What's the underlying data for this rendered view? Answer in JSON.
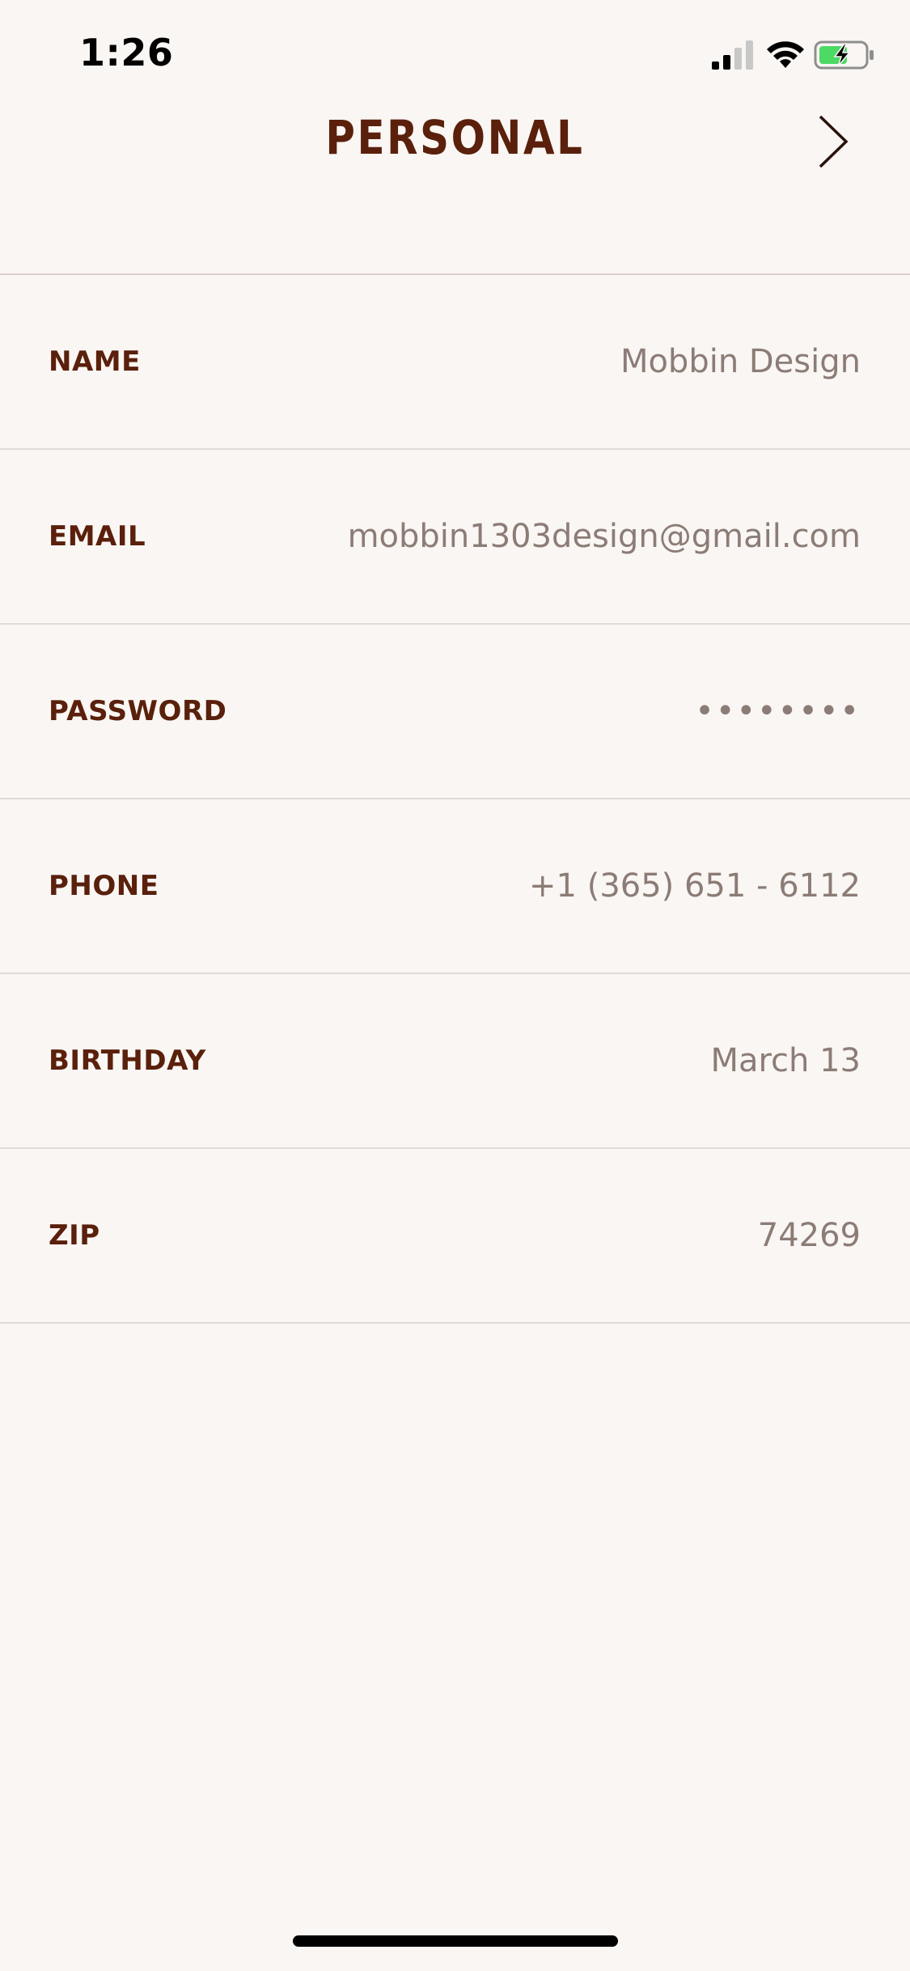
{
  "status_bar": {
    "time": "1:26",
    "signal_icon": "cellular-signal-icon",
    "wifi_icon": "wifi-icon",
    "battery_icon": "battery-charging-icon",
    "battery_color": "#4cd964"
  },
  "header": {
    "title": "PERSONAL",
    "next_icon": "chevron-right-icon"
  },
  "fields": [
    {
      "label": "NAME",
      "value": "Mobbin Design"
    },
    {
      "label": "EMAIL",
      "value": "mobbin1303design@gmail.com"
    },
    {
      "label": "PASSWORD",
      "value": "••••••••"
    },
    {
      "label": "PHONE",
      "value": "+1 (365) 651 - 6112"
    },
    {
      "label": "BIRTHDAY",
      "value": "March 13"
    },
    {
      "label": "ZIP",
      "value": "74269"
    }
  ],
  "colors": {
    "background": "#f9f6f3",
    "label": "#5a200c",
    "value": "#8c7c76",
    "divider": "#dedbd9"
  }
}
